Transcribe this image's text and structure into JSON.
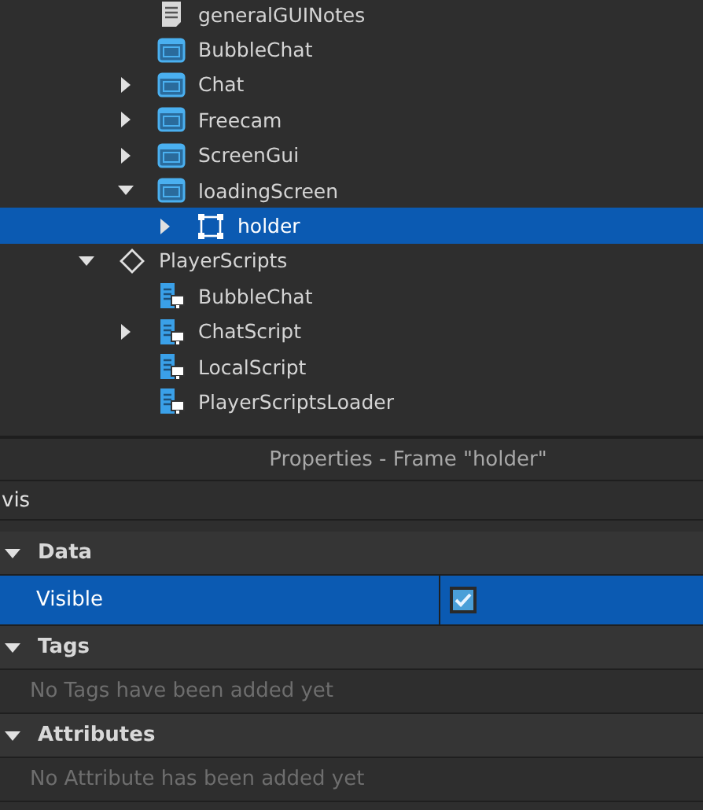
{
  "explorer": {
    "tree": [
      {
        "children": [
          {
            "label": "generalGUINotes",
            "kind": "notes",
            "selected": false
          },
          {
            "label": "BubbleChat",
            "kind": "gui",
            "selected": false
          },
          {
            "label": "Chat",
            "kind": "gui",
            "expanded": false,
            "selected": false
          },
          {
            "label": "Freecam",
            "kind": "gui",
            "expanded": false,
            "selected": false
          },
          {
            "label": "ScreenGui",
            "kind": "gui",
            "expanded": false,
            "selected": false
          },
          {
            "label": "loadingScreen",
            "kind": "gui",
            "expanded": true,
            "selected": false,
            "children": [
              {
                "label": "holder",
                "kind": "frame",
                "expanded": false,
                "selected": true
              }
            ]
          }
        ]
      },
      {
        "label": "PlayerScripts",
        "kind": "folder",
        "expanded": true,
        "selected": false,
        "children": [
          {
            "label": "BubbleChat",
            "kind": "script",
            "selected": false
          },
          {
            "label": "ChatScript",
            "kind": "script",
            "expanded": false,
            "selected": false
          },
          {
            "label": "LocalScript",
            "kind": "script",
            "selected": false
          },
          {
            "label": "PlayerScriptsLoader",
            "kind": "script",
            "selected": false
          }
        ]
      }
    ]
  },
  "properties": {
    "title": "Properties - Frame \"holder\"",
    "search": {
      "value": "vis"
    },
    "sections": [
      {
        "title": "Data",
        "expanded": true,
        "rows": [
          {
            "name": "Visible",
            "checked": true,
            "selected": true
          }
        ]
      },
      {
        "title": "Tags",
        "expanded": true,
        "empty_message": "No Tags have been added yet"
      },
      {
        "title": "Attributes",
        "expanded": true,
        "empty_message": "No Attribute has been added yet"
      }
    ]
  }
}
